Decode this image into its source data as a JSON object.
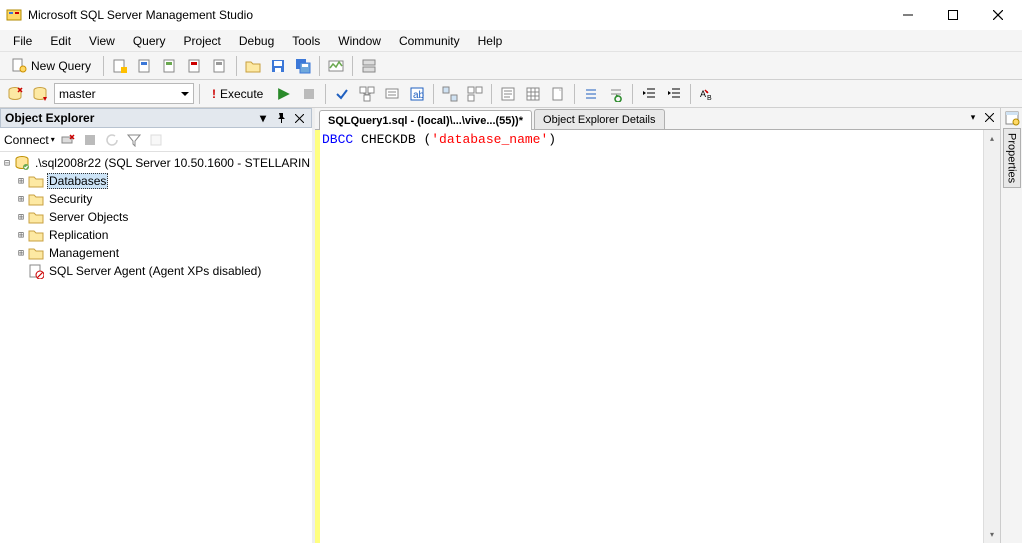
{
  "titlebar": {
    "title": "Microsoft SQL Server Management Studio"
  },
  "menu": [
    "File",
    "Edit",
    "View",
    "Query",
    "Project",
    "Debug",
    "Tools",
    "Window",
    "Community",
    "Help"
  ],
  "toolbar1": {
    "new_query": "New Query"
  },
  "toolbar2": {
    "database": "master",
    "execute": "Execute"
  },
  "object_explorer": {
    "title": "Object Explorer",
    "connect": "Connect",
    "root": ".\\sql2008r22 (SQL Server 10.50.1600 - STELLARIN",
    "nodes": [
      "Databases",
      "Security",
      "Server Objects",
      "Replication",
      "Management",
      "SQL Server Agent (Agent XPs disabled)"
    ]
  },
  "tabs": {
    "active": "SQLQuery1.sql - (local)\\...\\vive...(55))*",
    "inactive": "Object Explorer Details"
  },
  "editor": {
    "kw": "DBCC",
    "fn": " CHECKDB ",
    "p_open": "(",
    "str": "'database_name'",
    "p_close": ")"
  },
  "properties_tab": "Properties"
}
